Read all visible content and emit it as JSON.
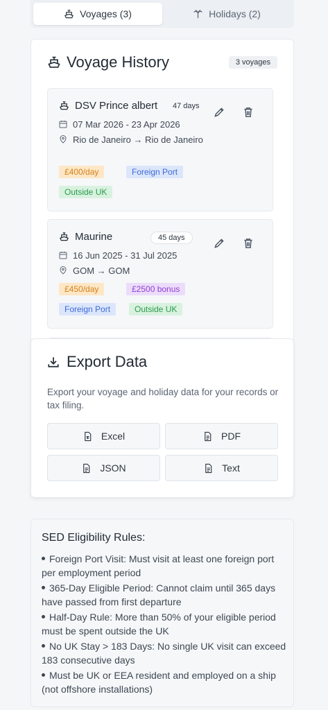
{
  "tabs": [
    {
      "label": "Voyages (3)",
      "icon": "ship-icon",
      "active": true
    },
    {
      "label": "Holidays (2)",
      "icon": "palm-tree-icon",
      "active": false
    }
  ],
  "history": {
    "title": "Voyage History",
    "count": "3 voyages",
    "voyages": [
      {
        "name": "DSV Prince albert",
        "days": "47 days",
        "dates": "07 Mar 2026 - 23 Apr 2026",
        "route": "Rio de Janeiro → Rio de Janeiro",
        "tags": [
          "£400/day",
          "Foreign Port",
          "Outside UK"
        ]
      },
      {
        "name": "Maurine",
        "days": "45 days",
        "dates": "16 Jun 2025 - 31 Jul 2025",
        "route": "GOM → GOM",
        "tags": [
          "£450/day",
          "£2500 bonus",
          "Foreign Port",
          "Outside UK"
        ]
      }
    ]
  },
  "export": {
    "title": "Export Data",
    "description": "Export your voyage and holiday data for your records or tax filing.",
    "buttons": [
      "Excel",
      "PDF",
      "JSON",
      "Text"
    ]
  },
  "rules": {
    "title": "SED Eligibility Rules:",
    "items": [
      "Foreign Port Visit: Must visit at least one foreign port per employment period",
      "365-Day Eligible Period: Cannot claim until 365 days have passed from first departure",
      "Half-Day Rule: More than 50% of your eligible period must be spent outside the UK",
      "No UK Stay > 183 Days: No single UK visit can exceed 183 consecutive days",
      "Must be UK or EEA resident and employed on a ship (not offshore installations)"
    ]
  },
  "colors": {
    "rate_tag": "#fde7c6",
    "foreign_port_tag": "#dbe6fb",
    "outside_uk_tag": "#d8f2df",
    "bonus_tag": "#ecdcfb"
  }
}
